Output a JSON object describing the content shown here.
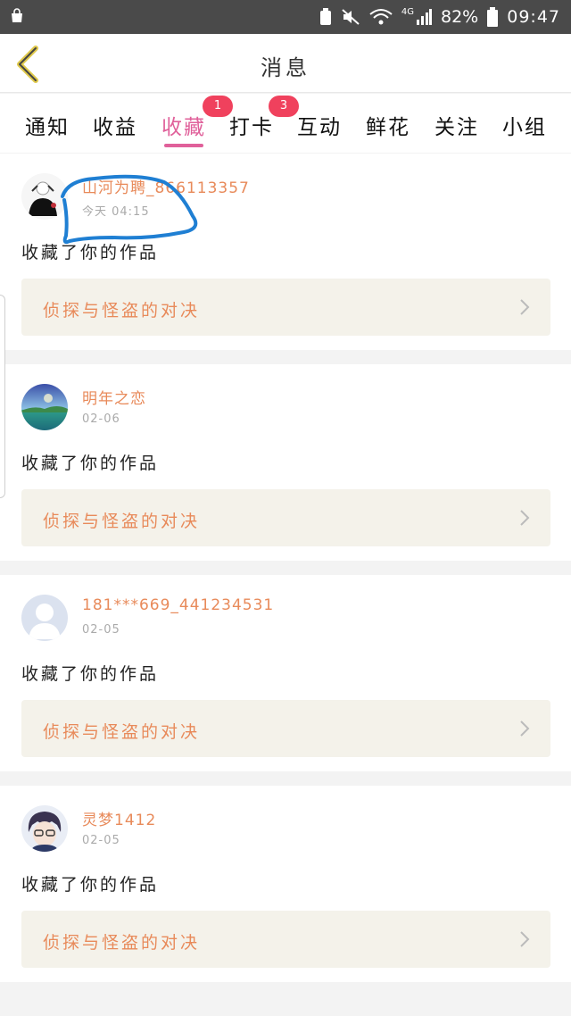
{
  "statusbar": {
    "battery": "82%",
    "clock": "09:47",
    "network": "4G"
  },
  "header": {
    "title": "消息"
  },
  "tabs": [
    {
      "label": "通知"
    },
    {
      "label": "收益"
    },
    {
      "label": "收藏",
      "active": true,
      "badge": "1"
    },
    {
      "label": "打卡",
      "badge": "3"
    },
    {
      "label": "互动"
    },
    {
      "label": "鲜花"
    },
    {
      "label": "关注"
    },
    {
      "label": "小组"
    }
  ],
  "messages": [
    {
      "username": "山河为聘_866113357",
      "time": "今天 04:15",
      "action": "收藏了你的作品",
      "work": "侦探与怪盗的对决",
      "avatar": "avatar-figure-icon"
    },
    {
      "username": "明年之恋",
      "time": "02-06",
      "action": "收藏了你的作品",
      "work": "侦探与怪盗的对决",
      "avatar": "avatar-landscape-icon"
    },
    {
      "username": "181***669_441234531",
      "time": "02-05",
      "action": "收藏了你的作品",
      "work": "侦探与怪盗的对决",
      "avatar": "avatar-default-icon"
    },
    {
      "username": "灵梦1412",
      "time": "02-05",
      "action": "收藏了你的作品",
      "work": "侦探与怪盗的对决",
      "avatar": "avatar-anime-icon"
    }
  ],
  "colors": {
    "accent": "#e0609a",
    "badge": "#f0415d",
    "username": "#e88a5a",
    "scribble": "#1f7fd3"
  }
}
